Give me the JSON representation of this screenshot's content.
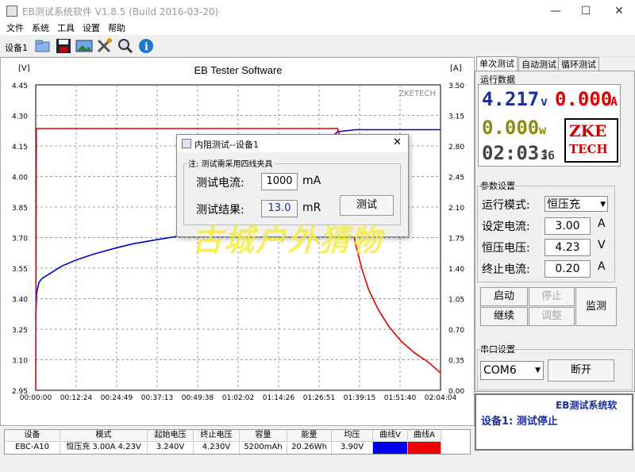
{
  "window": {
    "title": "EB测试系统软件 V1.8.5 (Build 2016-03-20)",
    "min": "—",
    "max": "☐",
    "close": "✕"
  },
  "menu": [
    "文件",
    "系统",
    "工具",
    "设置",
    "帮助"
  ],
  "toolbar": {
    "device_label": "设备1",
    "icons": [
      "open-folder-icon",
      "save-icon",
      "image-icon",
      "tools-icon",
      "magnifier-icon",
      "info-icon"
    ]
  },
  "chart_data": {
    "type": "line",
    "title": "EB Tester Software",
    "watermark_text": "ZKETECH",
    "yleft_unit": "[V]",
    "yright_unit": "[A]",
    "yleft_range": [
      2.95,
      4.45
    ],
    "yright_range": [
      0.0,
      3.5
    ],
    "yleft_ticks": [
      "4.45",
      "4.30",
      "4.15",
      "4.00",
      "3.85",
      "3.70",
      "3.55",
      "3.40",
      "3.25",
      "3.10",
      "2.95"
    ],
    "yright_ticks": [
      "3.50",
      "3.15",
      "2.80",
      "2.45",
      "2.10",
      "1.75",
      "1.40",
      "1.05",
      "0.70",
      "0.35",
      "0.00"
    ],
    "x_ticks": [
      "00:00:00",
      "00:12:24",
      "00:24:49",
      "00:37:13",
      "00:49:38",
      "01:02:02",
      "01:14:26",
      "01:26:51",
      "01:39:15",
      "01:51:40",
      "02:04:04"
    ],
    "series": [
      {
        "name": "曲线V",
        "color": "#0000cc",
        "axis": "left",
        "x": [
          0,
          0.3,
          1,
          2,
          4,
          6,
          8,
          12.4,
          18,
          24.8,
          30,
          37.2,
          45,
          49.6,
          55,
          62,
          70,
          78,
          86,
          92.5,
          98,
          124
        ],
        "y": [
          3.3,
          3.43,
          3.48,
          3.5,
          3.52,
          3.54,
          3.56,
          3.59,
          3.62,
          3.65,
          3.67,
          3.69,
          3.71,
          3.73,
          3.78,
          3.85,
          3.94,
          4.03,
          4.12,
          4.22,
          4.23,
          4.23
        ]
      },
      {
        "name": "曲线A",
        "color": "#dd0000",
        "axis": "right",
        "x": [
          0,
          0.2,
          0.5,
          92.5,
          93,
          94,
          96,
          98,
          100,
          102,
          105,
          108,
          112,
          116,
          120,
          124
        ],
        "y": [
          0.0,
          3.0,
          3.0,
          3.0,
          2.93,
          2.62,
          2.08,
          1.67,
          1.38,
          1.15,
          0.92,
          0.74,
          0.56,
          0.43,
          0.33,
          0.2
        ]
      }
    ]
  },
  "tabs": [
    "单次测试",
    "自动测试",
    "循环测试"
  ],
  "run_data": {
    "label": "运行数据",
    "voltage": "4.217",
    "voltage_unit": "v",
    "current": "0.000",
    "current_unit": "A",
    "power": "0.000",
    "power_unit": "w",
    "time": "02:03:",
    "time_sec": "36",
    "logo1": "ZKE",
    "logo2": "TECH"
  },
  "params": {
    "label": "参数设置",
    "mode_label": "运行模式:",
    "mode_value": "恒压充",
    "set_current_label": "设定电流:",
    "set_current": "3.00",
    "set_current_unit": "A",
    "cv_label": "恒压电压:",
    "cv": "4.23",
    "cv_unit": "V",
    "end_current_label": "终止电流:",
    "end_current": "0.20",
    "end_current_unit": "A"
  },
  "controls": {
    "start": "启动",
    "stop": "停止",
    "resume": "继续",
    "adjust": "调整",
    "monitor": "监测"
  },
  "serial": {
    "label": "串口设置",
    "port": "COM6",
    "open": "断开"
  },
  "status": {
    "system": "EB测试系统软",
    "text": "设备1: 测试停止"
  },
  "dialog": {
    "title": "内阻测试--设备1",
    "note": "注: 测试需采用四线夹具",
    "current_label": "测试电流:",
    "current_value": "1000",
    "current_unit": "mA",
    "result_label": "测试结果:",
    "result_value": "13.0",
    "result_unit": "mR",
    "test_button": "测试",
    "close": "✕"
  },
  "table": {
    "headers": [
      "设备",
      "模式",
      "起始电压",
      "终止电压",
      "容量",
      "能量",
      "均压",
      "曲线V",
      "曲线A"
    ],
    "row": {
      "device": "EBC-A10",
      "mode": "恒压充  3.00A  4.23V",
      "start_v": "3.240V",
      "end_v": "4.230V",
      "capacity": "5200mAh",
      "energy": "20.26Wh",
      "avg_v": "3.90V",
      "curve_v_color": "#0000ee",
      "curve_a_color": "#ee0000"
    }
  },
  "overlay_watermark": "古城户外猜物"
}
